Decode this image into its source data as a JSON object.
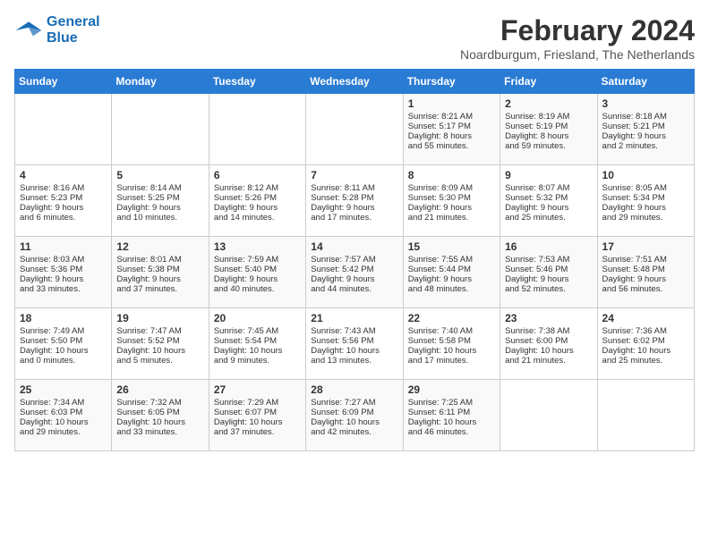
{
  "header": {
    "logo_line1": "General",
    "logo_line2": "Blue",
    "month_title": "February 2024",
    "subtitle": "Noardburgum, Friesland, The Netherlands"
  },
  "days_of_week": [
    "Sunday",
    "Monday",
    "Tuesday",
    "Wednesday",
    "Thursday",
    "Friday",
    "Saturday"
  ],
  "weeks": [
    [
      {
        "day": "",
        "content": ""
      },
      {
        "day": "",
        "content": ""
      },
      {
        "day": "",
        "content": ""
      },
      {
        "day": "",
        "content": ""
      },
      {
        "day": "1",
        "content": "Sunrise: 8:21 AM\nSunset: 5:17 PM\nDaylight: 8 hours\nand 55 minutes."
      },
      {
        "day": "2",
        "content": "Sunrise: 8:19 AM\nSunset: 5:19 PM\nDaylight: 8 hours\nand 59 minutes."
      },
      {
        "day": "3",
        "content": "Sunrise: 8:18 AM\nSunset: 5:21 PM\nDaylight: 9 hours\nand 2 minutes."
      }
    ],
    [
      {
        "day": "4",
        "content": "Sunrise: 8:16 AM\nSunset: 5:23 PM\nDaylight: 9 hours\nand 6 minutes."
      },
      {
        "day": "5",
        "content": "Sunrise: 8:14 AM\nSunset: 5:25 PM\nDaylight: 9 hours\nand 10 minutes."
      },
      {
        "day": "6",
        "content": "Sunrise: 8:12 AM\nSunset: 5:26 PM\nDaylight: 9 hours\nand 14 minutes."
      },
      {
        "day": "7",
        "content": "Sunrise: 8:11 AM\nSunset: 5:28 PM\nDaylight: 9 hours\nand 17 minutes."
      },
      {
        "day": "8",
        "content": "Sunrise: 8:09 AM\nSunset: 5:30 PM\nDaylight: 9 hours\nand 21 minutes."
      },
      {
        "day": "9",
        "content": "Sunrise: 8:07 AM\nSunset: 5:32 PM\nDaylight: 9 hours\nand 25 minutes."
      },
      {
        "day": "10",
        "content": "Sunrise: 8:05 AM\nSunset: 5:34 PM\nDaylight: 9 hours\nand 29 minutes."
      }
    ],
    [
      {
        "day": "11",
        "content": "Sunrise: 8:03 AM\nSunset: 5:36 PM\nDaylight: 9 hours\nand 33 minutes."
      },
      {
        "day": "12",
        "content": "Sunrise: 8:01 AM\nSunset: 5:38 PM\nDaylight: 9 hours\nand 37 minutes."
      },
      {
        "day": "13",
        "content": "Sunrise: 7:59 AM\nSunset: 5:40 PM\nDaylight: 9 hours\nand 40 minutes."
      },
      {
        "day": "14",
        "content": "Sunrise: 7:57 AM\nSunset: 5:42 PM\nDaylight: 9 hours\nand 44 minutes."
      },
      {
        "day": "15",
        "content": "Sunrise: 7:55 AM\nSunset: 5:44 PM\nDaylight: 9 hours\nand 48 minutes."
      },
      {
        "day": "16",
        "content": "Sunrise: 7:53 AM\nSunset: 5:46 PM\nDaylight: 9 hours\nand 52 minutes."
      },
      {
        "day": "17",
        "content": "Sunrise: 7:51 AM\nSunset: 5:48 PM\nDaylight: 9 hours\nand 56 minutes."
      }
    ],
    [
      {
        "day": "18",
        "content": "Sunrise: 7:49 AM\nSunset: 5:50 PM\nDaylight: 10 hours\nand 0 minutes."
      },
      {
        "day": "19",
        "content": "Sunrise: 7:47 AM\nSunset: 5:52 PM\nDaylight: 10 hours\nand 5 minutes."
      },
      {
        "day": "20",
        "content": "Sunrise: 7:45 AM\nSunset: 5:54 PM\nDaylight: 10 hours\nand 9 minutes."
      },
      {
        "day": "21",
        "content": "Sunrise: 7:43 AM\nSunset: 5:56 PM\nDaylight: 10 hours\nand 13 minutes."
      },
      {
        "day": "22",
        "content": "Sunrise: 7:40 AM\nSunset: 5:58 PM\nDaylight: 10 hours\nand 17 minutes."
      },
      {
        "day": "23",
        "content": "Sunrise: 7:38 AM\nSunset: 6:00 PM\nDaylight: 10 hours\nand 21 minutes."
      },
      {
        "day": "24",
        "content": "Sunrise: 7:36 AM\nSunset: 6:02 PM\nDaylight: 10 hours\nand 25 minutes."
      }
    ],
    [
      {
        "day": "25",
        "content": "Sunrise: 7:34 AM\nSunset: 6:03 PM\nDaylight: 10 hours\nand 29 minutes."
      },
      {
        "day": "26",
        "content": "Sunrise: 7:32 AM\nSunset: 6:05 PM\nDaylight: 10 hours\nand 33 minutes."
      },
      {
        "day": "27",
        "content": "Sunrise: 7:29 AM\nSunset: 6:07 PM\nDaylight: 10 hours\nand 37 minutes."
      },
      {
        "day": "28",
        "content": "Sunrise: 7:27 AM\nSunset: 6:09 PM\nDaylight: 10 hours\nand 42 minutes."
      },
      {
        "day": "29",
        "content": "Sunrise: 7:25 AM\nSunset: 6:11 PM\nDaylight: 10 hours\nand 46 minutes."
      },
      {
        "day": "",
        "content": ""
      },
      {
        "day": "",
        "content": ""
      }
    ]
  ]
}
